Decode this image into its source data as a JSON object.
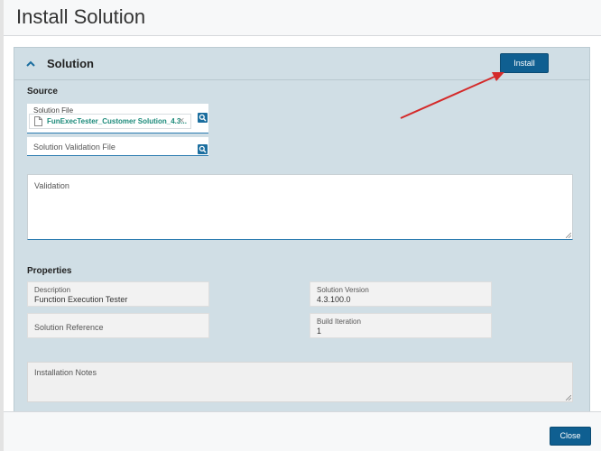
{
  "header": {
    "title": "Install Solution"
  },
  "panel": {
    "title": "Solution",
    "install_label": "Install",
    "icons": {
      "collapse": "chevron-up-icon",
      "file": "file-icon",
      "search": "search-icon",
      "remove": "close-icon"
    },
    "source": {
      "heading": "Source",
      "solution_file": {
        "label": "Solution File",
        "value": "FunExecTester_Customer Solution_4.3...",
        "remove_glyph": "×"
      },
      "validation_file": {
        "placeholder": "Solution Validation File"
      },
      "validation_area": {
        "placeholder": "Validation"
      }
    },
    "properties": {
      "heading": "Properties",
      "description": {
        "label": "Description",
        "value": "Function Execution Tester"
      },
      "solution_version": {
        "label": "Solution Version",
        "value": "4.3.100.0"
      },
      "solution_reference": {
        "label": "Solution Reference"
      },
      "build_iteration": {
        "label": "Build Iteration",
        "value": "1"
      },
      "installation_notes": {
        "placeholder": "Installation Notes"
      }
    }
  },
  "footer": {
    "close_label": "Close"
  },
  "colors": {
    "primary_button": "#0f5f91",
    "panel_bg": "#d0dee5",
    "file_link": "#1b8a7a",
    "annotation_arrow": "#d42a2a"
  }
}
